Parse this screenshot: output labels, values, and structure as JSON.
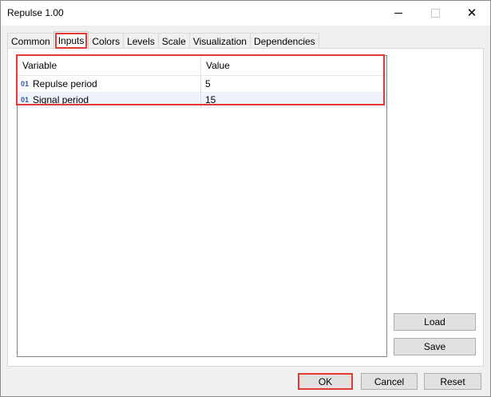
{
  "window": {
    "title": "Repulse 1.00"
  },
  "titlebar_buttons": {
    "minimize": "minimize-icon",
    "maximize": "maximize-icon",
    "close": "close-icon",
    "close_glyph": "✕"
  },
  "tabs": [
    {
      "label": "Common"
    },
    {
      "label": "Inputs",
      "active": true
    },
    {
      "label": "Colors"
    },
    {
      "label": "Levels"
    },
    {
      "label": "Scale"
    },
    {
      "label": "Visualization"
    },
    {
      "label": "Dependencies"
    }
  ],
  "grid": {
    "columns": [
      "Variable",
      "Value"
    ],
    "rows": [
      {
        "icon": "01",
        "variable": "Repulse period",
        "value": "5"
      },
      {
        "icon": "01",
        "variable": "Signal period",
        "value": "15"
      }
    ]
  },
  "side_buttons": {
    "load": "Load",
    "save": "Save"
  },
  "footer": {
    "ok": "OK",
    "cancel": "Cancel",
    "reset": "Reset"
  },
  "colors": {
    "highlight": "#e53935",
    "selected_row": "#eef2fb",
    "icon": "#2a5ab0"
  }
}
